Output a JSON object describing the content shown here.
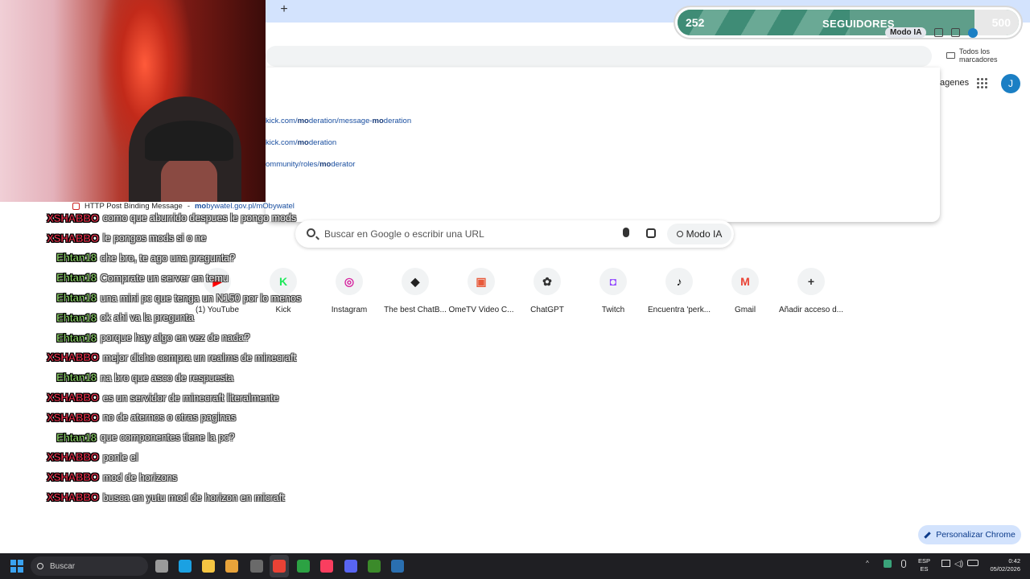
{
  "browser": {
    "bookmarks_label": "Todos los marcadores",
    "new_tab_glyph": "+",
    "tab_close_glyph": "×"
  },
  "dropdown": {
    "suggestions": [
      {
        "pre": "kick.com/",
        "bold": "mo",
        "mid": "deration/message-",
        "bold2": "mo",
        "post": "deration"
      },
      {
        "pre": "kick.com/",
        "bold": "mo",
        "mid": "deration",
        "bold2": "",
        "post": ""
      },
      {
        "pre": "ommunity/roles/",
        "bold": "mo",
        "mid": "derator",
        "bold2": "",
        "post": ""
      }
    ],
    "last": {
      "title": "HTTP Post Binding Message",
      "sep": "-",
      "bold": "mo",
      "url": "bywatel.gov.pl/mObywatel"
    }
  },
  "ntp": {
    "images_link": "agenes",
    "avatar_letter": "J",
    "search_placeholder": "Buscar en Google o escribir una URL",
    "ai_mode_label": "Modo IA",
    "shortcuts": [
      {
        "label": "(1) YouTube",
        "icon": "youtube-icon",
        "glyph": "▶",
        "color": "#ff0000"
      },
      {
        "label": "Kick",
        "icon": "kick-icon",
        "glyph": "K",
        "color": "#1ee85a"
      },
      {
        "label": "Instagram",
        "icon": "instagram-icon",
        "glyph": "◎",
        "color": "#d6249f"
      },
      {
        "label": "The best ChatB...",
        "icon": "chatbot-icon",
        "glyph": "◆",
        "color": "#222222"
      },
      {
        "label": "OmeTV Video C...",
        "icon": "ometv-icon",
        "glyph": "▣",
        "color": "#e85a3a"
      },
      {
        "label": "ChatGPT",
        "icon": "chatgpt-icon",
        "glyph": "✿",
        "color": "#333333"
      },
      {
        "label": "Twitch",
        "icon": "twitch-icon",
        "glyph": "◘",
        "color": "#9146ff"
      },
      {
        "label": "Encuentra 'perk...",
        "icon": "tiktok-icon",
        "glyph": "♪",
        "color": "#000000"
      },
      {
        "label": "Gmail",
        "icon": "gmail-icon",
        "glyph": "M",
        "color": "#ea4335"
      },
      {
        "label": "Añadir acceso d...",
        "icon": "add-icon",
        "glyph": "+",
        "color": "#333333"
      }
    ],
    "customize_label": "Personalizar Chrome"
  },
  "goal": {
    "current": "252",
    "title": "SEGUIDORES",
    "max": "500",
    "progress": 0.504
  },
  "extensions": {
    "ai_chip": "Modo IA"
  },
  "chat": [
    {
      "user": "XSHABBO",
      "color": "red",
      "text": "como que aburrido despues le pongo mods"
    },
    {
      "user": "XSHABBO",
      "color": "red",
      "text": "le pongos mods si o ne"
    },
    {
      "user": "Ehtan18",
      "color": "green",
      "text": "che bro, te ago una pregunta?"
    },
    {
      "user": "Ehtan18",
      "color": "green",
      "text": "Comprate un server en temu"
    },
    {
      "user": "Ehtan18",
      "color": "green",
      "text": "una mini pc que tenga un N150 por lo menos"
    },
    {
      "user": "Ehtan18",
      "color": "green",
      "text": "ok ahi va la pregunta"
    },
    {
      "user": "Ehtan18",
      "color": "green",
      "text": "porque hay algo en vez de nada?"
    },
    {
      "user": "XSHABBO",
      "color": "red",
      "text": "mejor dicho compra un realms de minecraft"
    },
    {
      "user": "Ehtan18",
      "color": "green",
      "text": "na bro que asco de respuesta"
    },
    {
      "user": "XSHABBO",
      "color": "red",
      "text": "es un servidor de minecraft literalmente"
    },
    {
      "user": "XSHABBO",
      "color": "red",
      "text": "no de aternos o otras paginas"
    },
    {
      "user": "Ehtan18",
      "color": "green",
      "text": "que componentes tiene la pc?"
    },
    {
      "user": "XSHABBO",
      "color": "red",
      "text": "ponle el"
    },
    {
      "user": "XSHABBO",
      "color": "red",
      "text": "mod de horizons"
    },
    {
      "user": "XSHABBO",
      "color": "red",
      "text": "busca en yutu mod de horizon en micraft"
    }
  ],
  "taskbar": {
    "search_label": "Buscar",
    "lang_top": "ESP",
    "lang_bottom": "ES",
    "time": "0:42",
    "date": "05/02/2026",
    "apps": [
      {
        "icon": "task-view-icon",
        "color": "#9a9a9a"
      },
      {
        "icon": "edge-icon",
        "color": "#1ba1e2"
      },
      {
        "icon": "file-explorer-icon",
        "color": "#f5c542"
      },
      {
        "icon": "media-player-icon",
        "color": "#e8a33a"
      },
      {
        "icon": "obs-icon",
        "color": "#6a6a6a"
      },
      {
        "icon": "chrome-icon",
        "color": "#e94235"
      },
      {
        "icon": "xbox-icon",
        "color": "#2ca243"
      },
      {
        "icon": "music-icon",
        "color": "#fa3e5f"
      },
      {
        "icon": "discord-icon",
        "color": "#5865f2"
      },
      {
        "icon": "minecraft-icon",
        "color": "#3b8a2a"
      },
      {
        "icon": "steam-icon",
        "color": "#2a6fb0"
      }
    ]
  }
}
